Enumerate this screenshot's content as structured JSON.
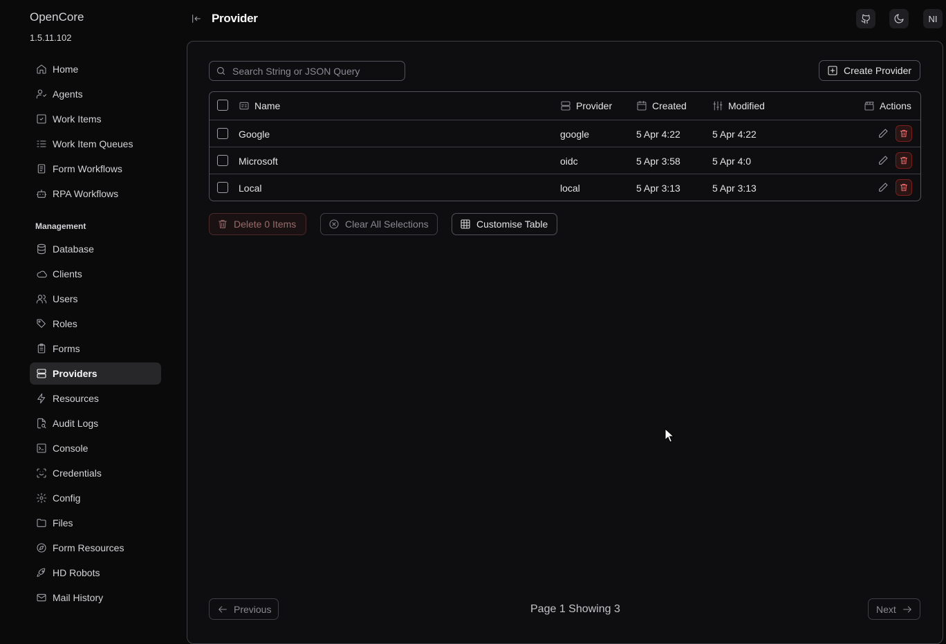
{
  "app": {
    "brand": "OpenCore",
    "version": "1.5.11.102"
  },
  "sidebar": {
    "items": [
      {
        "label": "Home",
        "icon": "home-icon"
      },
      {
        "label": "Agents",
        "icon": "agent-icon"
      },
      {
        "label": "Work Items",
        "icon": "work-items-icon"
      },
      {
        "label": "Work Item Queues",
        "icon": "queue-icon"
      },
      {
        "label": "Form Workflows",
        "icon": "form-workflow-icon"
      },
      {
        "label": "RPA Workflows",
        "icon": "robot-icon"
      }
    ],
    "management_label": "Management",
    "management": [
      {
        "label": "Database",
        "icon": "database-icon"
      },
      {
        "label": "Clients",
        "icon": "cloud-icon"
      },
      {
        "label": "Users",
        "icon": "users-icon"
      },
      {
        "label": "Roles",
        "icon": "tag-icon"
      },
      {
        "label": "Forms",
        "icon": "clipboard-icon"
      },
      {
        "label": "Providers",
        "icon": "server-icon",
        "active": true
      },
      {
        "label": "Resources",
        "icon": "bolt-icon"
      },
      {
        "label": "Audit Logs",
        "icon": "file-search-icon"
      },
      {
        "label": "Console",
        "icon": "terminal-icon"
      },
      {
        "label": "Credentials",
        "icon": "scan-face-icon"
      },
      {
        "label": "Config",
        "icon": "gear-icon"
      },
      {
        "label": "Files",
        "icon": "folder-icon"
      },
      {
        "label": "Form Resources",
        "icon": "compass-icon"
      },
      {
        "label": "HD Robots",
        "icon": "rocket-icon"
      },
      {
        "label": "Mail History",
        "icon": "mail-icon"
      }
    ]
  },
  "header": {
    "title": "Provider",
    "avatar": "NI"
  },
  "search": {
    "placeholder": "Search String or JSON Query"
  },
  "create_button": "Create Provider",
  "table": {
    "columns": {
      "name": "Name",
      "provider": "Provider",
      "created": "Created",
      "modified": "Modified",
      "actions": "Actions"
    },
    "rows": [
      {
        "name": "Google",
        "provider": "google",
        "created": "5 Apr 4:22",
        "modified": "5 Apr 4:22"
      },
      {
        "name": "Microsoft",
        "provider": "oidc",
        "created": "5 Apr 3:58",
        "modified": "5 Apr 4:0"
      },
      {
        "name": "Local",
        "provider": "local",
        "created": "5 Apr 3:13",
        "modified": "5 Apr 3:13"
      }
    ]
  },
  "bulk": {
    "delete_label": "Delete 0 Items",
    "clear_label": "Clear All Selections",
    "customise_label": "Customise Table"
  },
  "pagination": {
    "previous": "Previous",
    "info": "Page 1 Showing 3",
    "next": "Next"
  },
  "colors": {
    "accent_danger": "#f87171",
    "active_nav_bg": "#27272a"
  }
}
